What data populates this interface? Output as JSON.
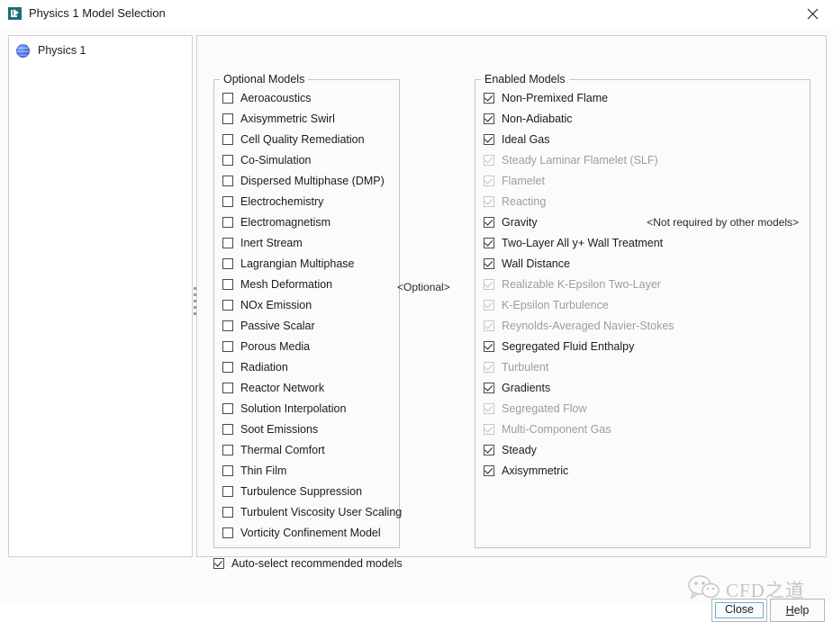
{
  "window": {
    "title": "Physics 1 Model Selection",
    "app_icon": "star-ccm-icon",
    "close_icon": "close-icon"
  },
  "tree": {
    "items": [
      {
        "label": "Physics 1",
        "icon": "physics-sphere-icon"
      }
    ]
  },
  "splitter": {
    "icon": "splitter-handle-icon"
  },
  "optional_tag": "<Optional>",
  "optional_models": {
    "title": "Optional Models",
    "items": [
      {
        "label": "Aeroacoustics",
        "checked": false,
        "enabled": true
      },
      {
        "label": "Axisymmetric Swirl",
        "checked": false,
        "enabled": true
      },
      {
        "label": "Cell Quality Remediation",
        "checked": false,
        "enabled": true
      },
      {
        "label": "Co-Simulation",
        "checked": false,
        "enabled": true
      },
      {
        "label": "Dispersed Multiphase (DMP)",
        "checked": false,
        "enabled": true
      },
      {
        "label": "Electrochemistry",
        "checked": false,
        "enabled": true
      },
      {
        "label": "Electromagnetism",
        "checked": false,
        "enabled": true
      },
      {
        "label": "Inert Stream",
        "checked": false,
        "enabled": true
      },
      {
        "label": "Lagrangian Multiphase",
        "checked": false,
        "enabled": true
      },
      {
        "label": "Mesh Deformation",
        "checked": false,
        "enabled": true
      },
      {
        "label": "NOx Emission",
        "checked": false,
        "enabled": true
      },
      {
        "label": "Passive Scalar",
        "checked": false,
        "enabled": true
      },
      {
        "label": "Porous Media",
        "checked": false,
        "enabled": true
      },
      {
        "label": "Radiation",
        "checked": false,
        "enabled": true
      },
      {
        "label": "Reactor Network",
        "checked": false,
        "enabled": true
      },
      {
        "label": "Solution Interpolation",
        "checked": false,
        "enabled": true
      },
      {
        "label": "Soot Emissions",
        "checked": false,
        "enabled": true
      },
      {
        "label": "Thermal Comfort",
        "checked": false,
        "enabled": true
      },
      {
        "label": "Thin Film",
        "checked": false,
        "enabled": true
      },
      {
        "label": "Turbulence Suppression",
        "checked": false,
        "enabled": true
      },
      {
        "label": "Turbulent Viscosity User Scaling",
        "checked": false,
        "enabled": true
      },
      {
        "label": "Vorticity Confinement Model",
        "checked": false,
        "enabled": true
      }
    ]
  },
  "enabled_models": {
    "title": "Enabled Models",
    "items": [
      {
        "label": "Non-Premixed Flame",
        "checked": true,
        "enabled": true,
        "note": ""
      },
      {
        "label": "Non-Adiabatic",
        "checked": true,
        "enabled": true,
        "note": ""
      },
      {
        "label": "Ideal Gas",
        "checked": true,
        "enabled": true,
        "note": ""
      },
      {
        "label": "Steady Laminar Flamelet (SLF)",
        "checked": true,
        "enabled": false,
        "note": ""
      },
      {
        "label": "Flamelet",
        "checked": true,
        "enabled": false,
        "note": ""
      },
      {
        "label": "Reacting",
        "checked": true,
        "enabled": false,
        "note": ""
      },
      {
        "label": "Gravity",
        "checked": true,
        "enabled": true,
        "note": "<Not required by other models>"
      },
      {
        "label": "Two-Layer All y+ Wall Treatment",
        "checked": true,
        "enabled": true,
        "note": ""
      },
      {
        "label": "Wall Distance",
        "checked": true,
        "enabled": true,
        "note": ""
      },
      {
        "label": "Realizable K-Epsilon Two-Layer",
        "checked": true,
        "enabled": false,
        "note": ""
      },
      {
        "label": "K-Epsilon Turbulence",
        "checked": true,
        "enabled": false,
        "note": ""
      },
      {
        "label": "Reynolds-Averaged Navier-Stokes",
        "checked": true,
        "enabled": false,
        "note": ""
      },
      {
        "label": "Segregated Fluid Enthalpy",
        "checked": true,
        "enabled": true,
        "note": ""
      },
      {
        "label": "Turbulent",
        "checked": true,
        "enabled": false,
        "note": ""
      },
      {
        "label": "Gradients",
        "checked": true,
        "enabled": true,
        "note": ""
      },
      {
        "label": "Segregated Flow",
        "checked": true,
        "enabled": false,
        "note": ""
      },
      {
        "label": "Multi-Component Gas",
        "checked": true,
        "enabled": false,
        "note": ""
      },
      {
        "label": "Steady",
        "checked": true,
        "enabled": true,
        "note": ""
      },
      {
        "label": "Axisymmetric",
        "checked": true,
        "enabled": true,
        "note": ""
      }
    ]
  },
  "auto_select": {
    "label": "Auto-select recommended models",
    "checked": true
  },
  "buttons": {
    "close": "Close",
    "help_prefix": "",
    "help_mnemonic": "H",
    "help_suffix": "elp"
  },
  "watermark": {
    "text": "CFD之道",
    "logo_icon": "wechat-icon"
  },
  "colors": {
    "dialog_bg": "#fbfbfb",
    "panel_bg": "#ffffff",
    "border": "#c4c4c4",
    "text": "#1b1b1b",
    "disabled_text": "#9d9d9d",
    "focus_accent": "#69b1d6"
  }
}
